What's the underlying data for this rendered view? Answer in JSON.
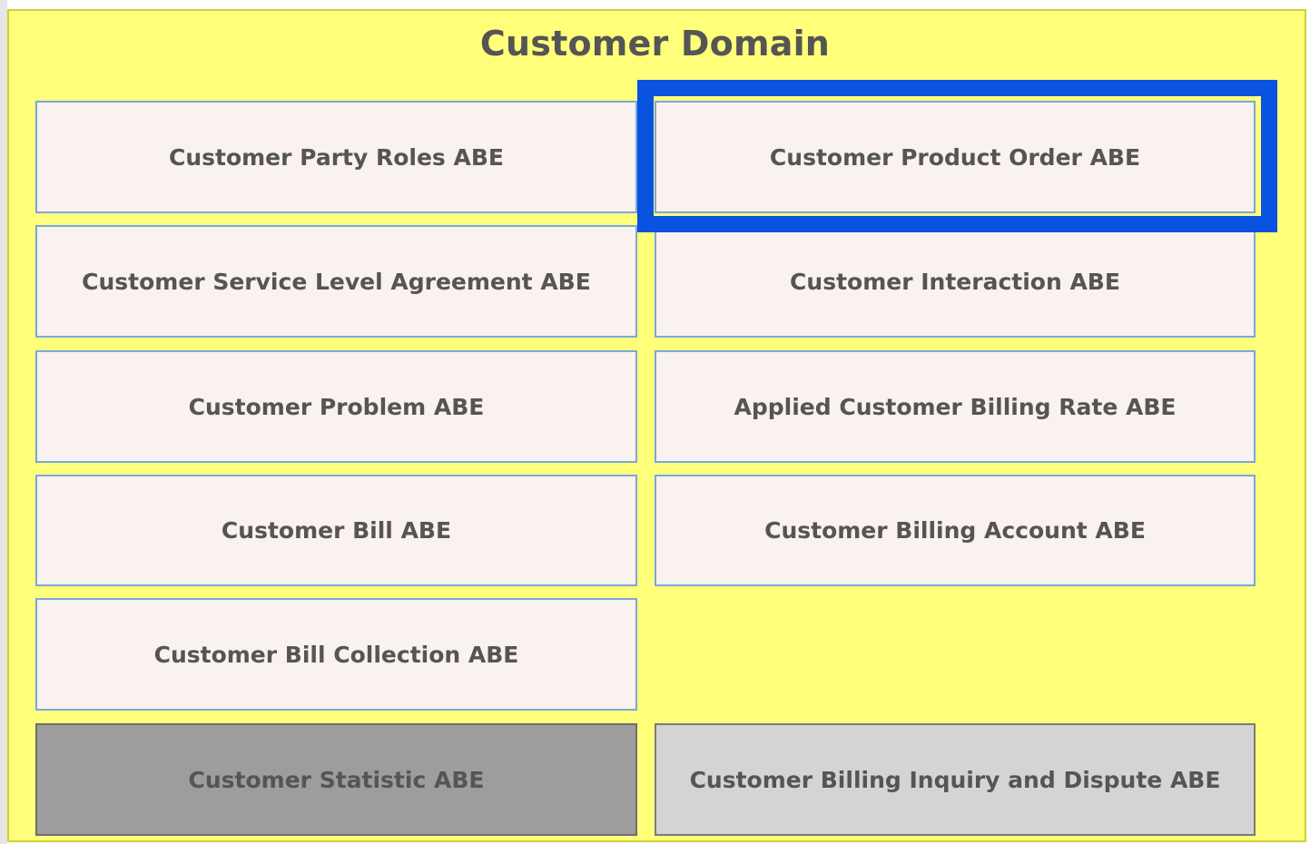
{
  "domain": {
    "title": "Customer Domain",
    "colors": {
      "background": "#ffff7a",
      "box_fill": "#faf2ee",
      "box_border": "#7ba7dd",
      "highlight": "#0a52e0",
      "gray_dark": "#9d9d9d",
      "gray_light": "#d4d4d4"
    },
    "boxes": [
      {
        "label": "Customer Party Roles ABE"
      },
      {
        "label": "Customer Product Order ABE",
        "highlighted": true
      },
      {
        "label": "Customer Service Level Agreement ABE"
      },
      {
        "label": "Customer Interaction ABE"
      },
      {
        "label": "Customer Problem ABE"
      },
      {
        "label": "Applied Customer Billing Rate ABE"
      },
      {
        "label": "Customer Bill ABE"
      },
      {
        "label": "Customer Billing Account ABE"
      },
      {
        "label": "Customer Bill Collection ABE"
      },
      {
        "label": "Customer Statistic ABE",
        "style": "gray-dark"
      },
      {
        "label": "Customer Billing Inquiry and Dispute ABE",
        "style": "gray-light"
      }
    ]
  }
}
